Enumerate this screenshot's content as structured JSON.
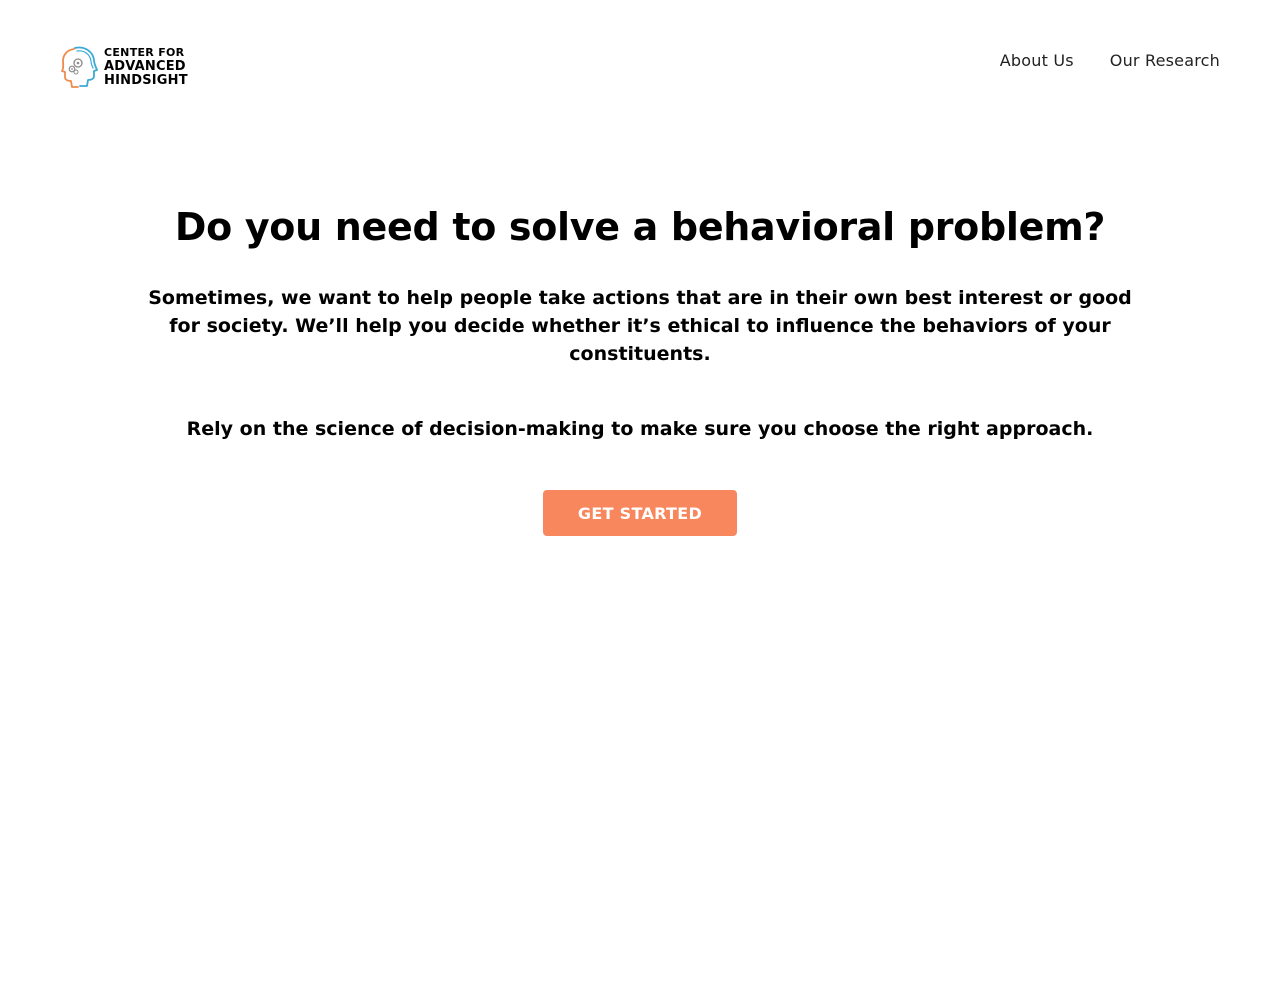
{
  "brand": {
    "line1": "CENTER FOR",
    "line2": "ADVANCED",
    "line3": "HINDSIGHT",
    "logo_icon": "head-profile-gears-icon",
    "colors": {
      "blue": "#3aa9d6",
      "orange": "#f08a4b",
      "gray": "#8a8a8a"
    }
  },
  "nav": {
    "items": [
      {
        "label": "About Us"
      },
      {
        "label": "Our Research"
      }
    ]
  },
  "hero": {
    "title": "Do you need to solve a behavioral problem?",
    "subtitle": "Sometimes, we want to help people take actions that are in their own best interest or good for society. We’ll help you decide whether it’s ethical to influence the behaviors of your constituents.",
    "tagline": "Rely on the science of decision-making to make sure you choose the right approach.",
    "cta_label": "GET STARTED"
  },
  "colors": {
    "accent": "#f9875d",
    "background": "#ffffff",
    "text": "#000000"
  }
}
